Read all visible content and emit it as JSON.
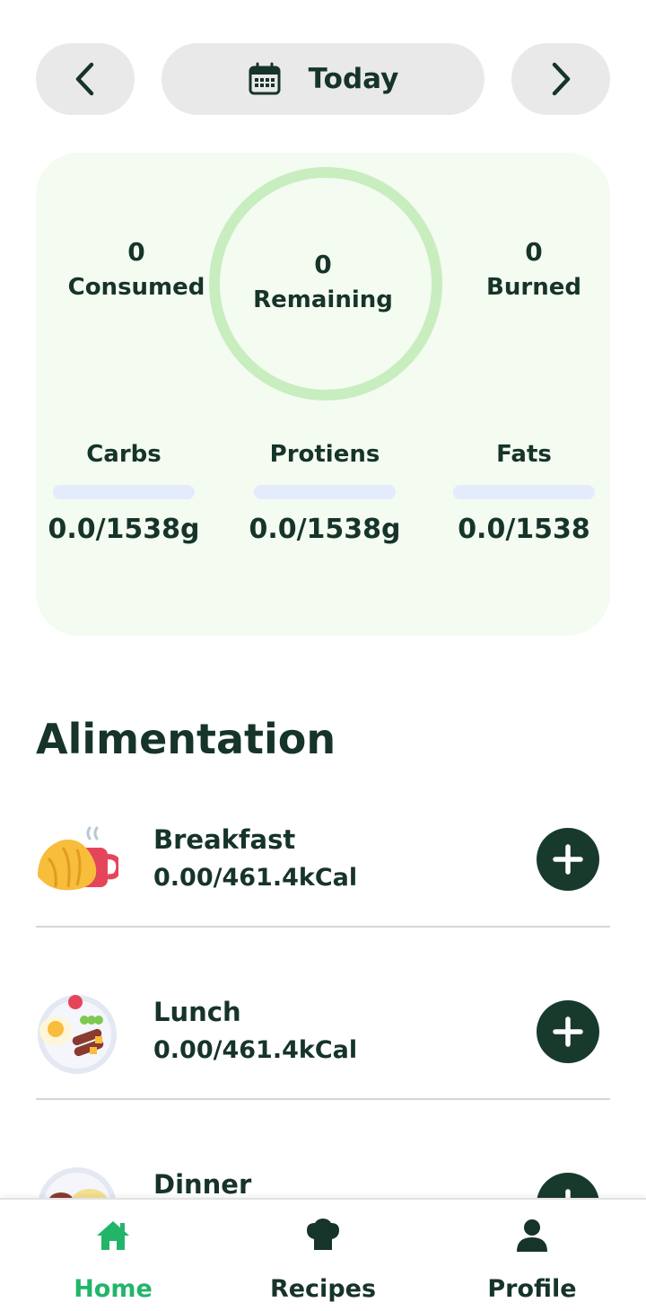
{
  "date_nav": {
    "prev_icon": "chevron-left-icon",
    "next_icon": "chevron-right-icon",
    "calendar_icon": "calendar-icon",
    "label": "Today"
  },
  "summary": {
    "consumed": {
      "value": "0",
      "label": "Consumed"
    },
    "remaining": {
      "value": "0",
      "label": "Remaining"
    },
    "burned": {
      "value": "0",
      "label": "Burned"
    },
    "ring_color": "#c8edbf",
    "card_color": "#f4fbf1",
    "macros": [
      {
        "label": "Carbs",
        "value": "0.0/1538g",
        "progress": 0
      },
      {
        "label": "Protiens",
        "value": "0.0/1538g",
        "progress": 0
      },
      {
        "label": "Fats",
        "value": "0.0/1538",
        "progress": 0
      }
    ]
  },
  "alimentation": {
    "title": "Alimentation",
    "meals": [
      {
        "name": "Breakfast",
        "calories": "0.00/461.4kCal",
        "icon": "breakfast-icon"
      },
      {
        "name": "Lunch",
        "calories": "0.00/461.4kCal",
        "icon": "lunch-icon"
      },
      {
        "name": "Dinner",
        "calories": "",
        "icon": "dinner-icon"
      }
    ],
    "add_icon": "plus-icon"
  },
  "bottom_nav": {
    "tabs": [
      {
        "label": "Home",
        "icon": "home-icon",
        "active": true
      },
      {
        "label": "Recipes",
        "icon": "chef-hat-icon",
        "active": false
      },
      {
        "label": "Profile",
        "icon": "user-icon",
        "active": false
      }
    ]
  },
  "colors": {
    "primary_dark": "#163429",
    "accent_green": "#22b56a",
    "button_gray": "#e9e9ea",
    "add_button": "#183a2c"
  }
}
